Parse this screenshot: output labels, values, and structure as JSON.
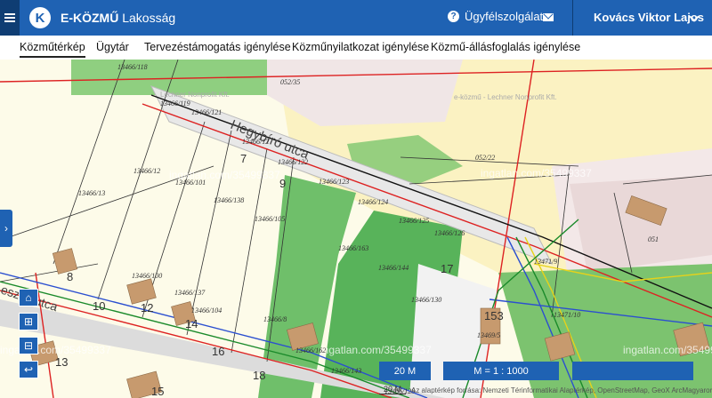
{
  "header": {
    "logo_letter": "K",
    "brand": "E-KÖZMŰ",
    "subtitle": " Lakosság",
    "support_label": "Ügyfélszolgálat",
    "user_name": "Kovács Viktor Lajos"
  },
  "tabs": [
    {
      "label": "Közműtérkép",
      "active": true
    },
    {
      "label": "Ügytár"
    },
    {
      "label": "Tervezéstámogatás igénylése"
    },
    {
      "label": "Közműnyilatkozat igénylése"
    },
    {
      "label": "Közmű-állásfoglalás igénylése"
    }
  ],
  "map": {
    "street_name": "Hegybíró utca",
    "street_name_2": "eszky utca",
    "owner_label_1": "Lechner Nonprofit Kft.",
    "owner_label_2": "e-közmű - Lechner Nonprofit Kft.",
    "watermarks": [
      "ingatlan.com/35499337",
      "ingatlan.com/35499337",
      "ingatlan.com/35499337",
      "ingatlan.com/35499337",
      "ingatlan.com/35499337"
    ],
    "parcels": [
      "13466/118",
      "052/35",
      "13466/119",
      "13466/12",
      "13466/121",
      "13466/122",
      "13466/12",
      "13466/101",
      "13466/13",
      "13466/138",
      "13466/105",
      "13466/123",
      "13466/124",
      "052/22",
      "13466/125",
      "13466/126",
      "051",
      "13466/163",
      "13466/144",
      "13466/100",
      "13466/137",
      "13466/104",
      "13466/8",
      "13466/130",
      "13466/162",
      "13466/143",
      "13466/129",
      "13469/5",
      "13471/9",
      "13471/10"
    ],
    "house_numbers": [
      "7",
      "9",
      "8",
      "10",
      "12",
      "14",
      "16",
      "13",
      "15",
      "18",
      "17",
      "153"
    ],
    "scale_bar": "20 M",
    "scale_ratio": "M = 1 : 1000",
    "scale_bar_small": "20 M",
    "attribution": "Az alaptérkép forrása: Nemzeti Térinformatikai Alaptérkép, OpenStreetMap, GeoX ArcMagyarország"
  }
}
